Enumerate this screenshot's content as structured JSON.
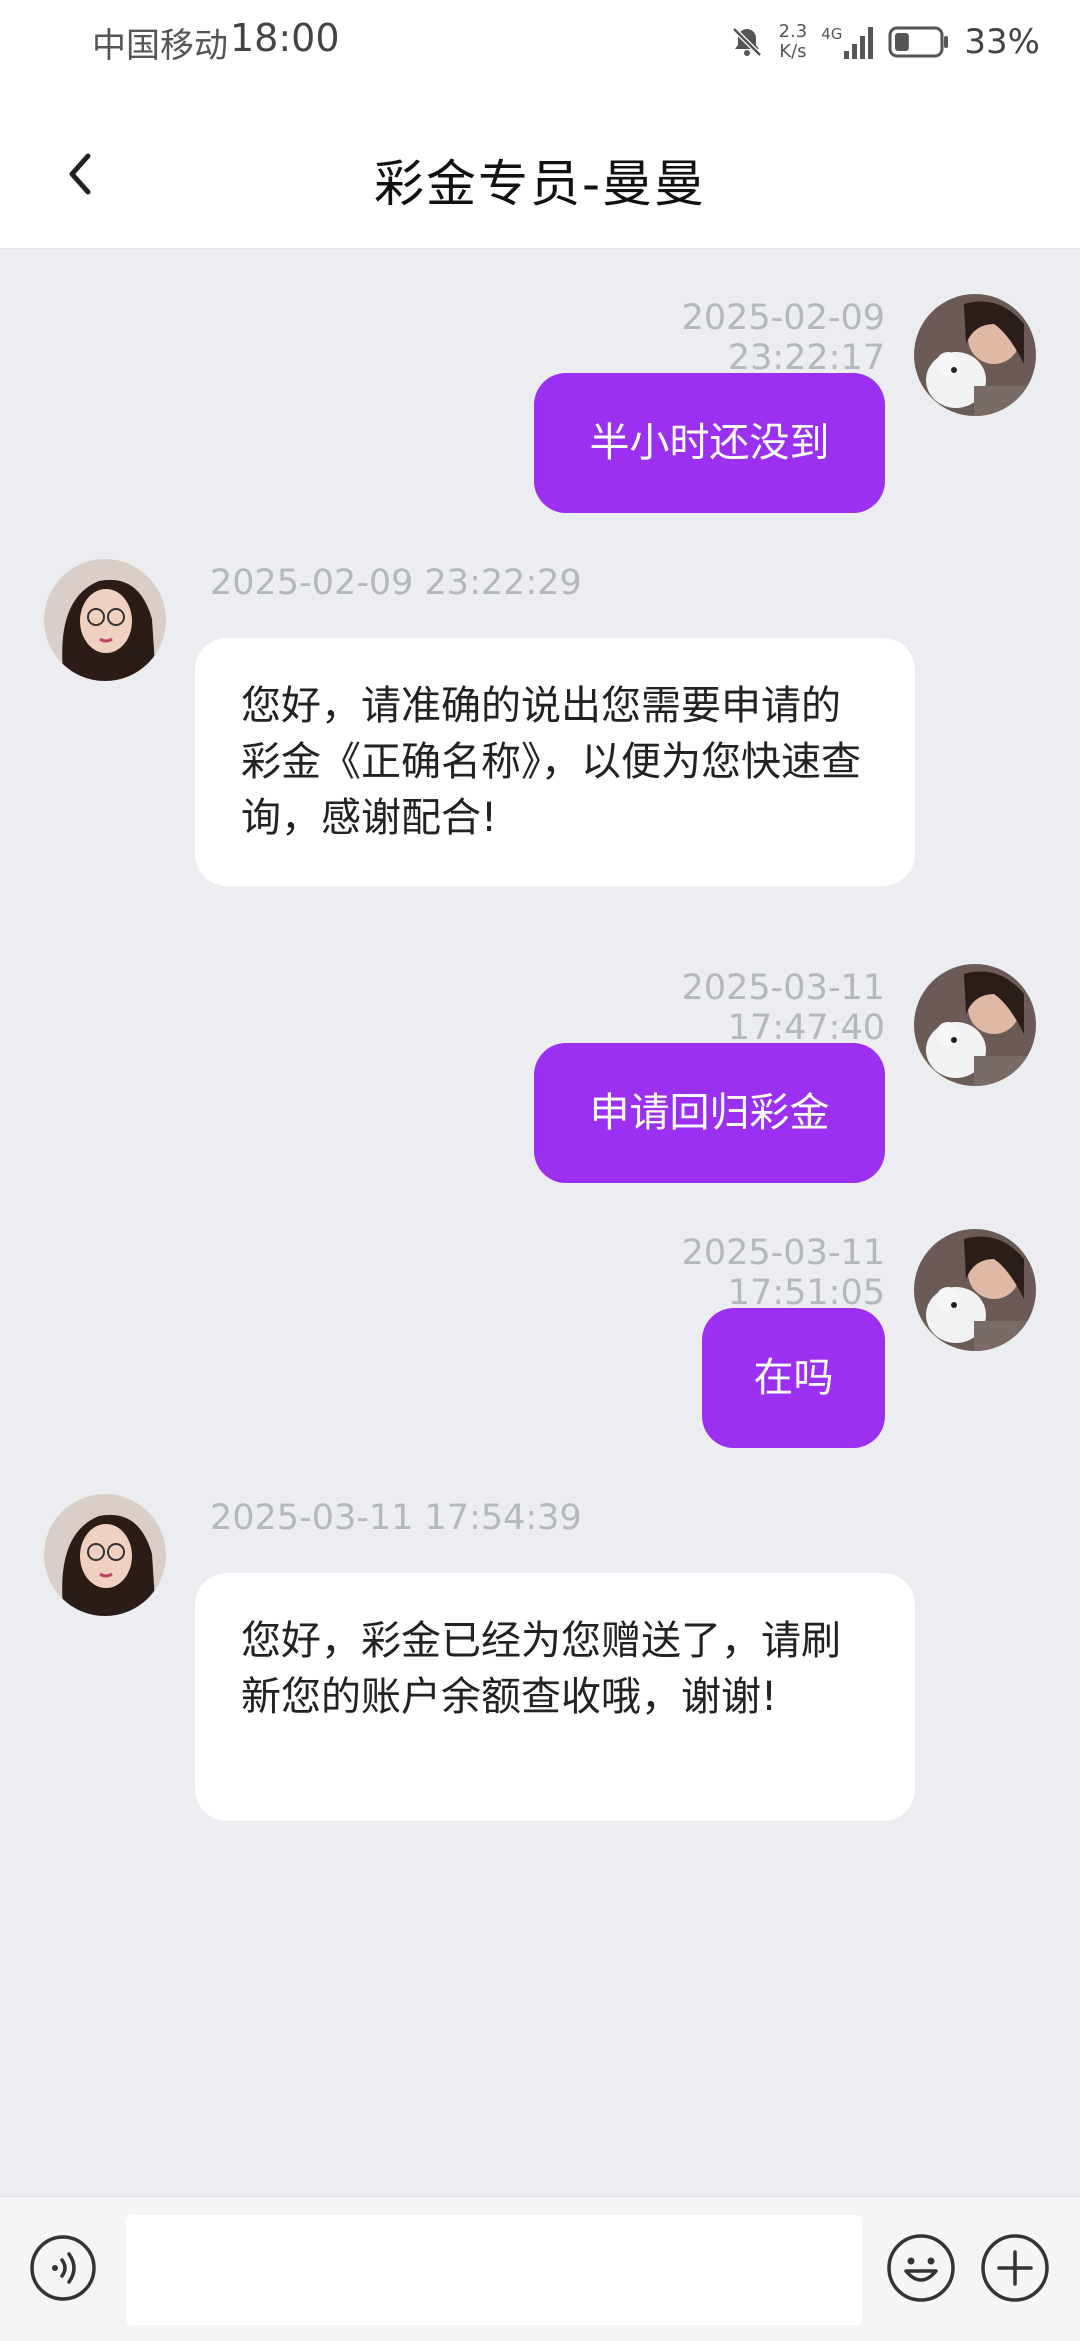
{
  "status_bar": {
    "carrier": "中国移动",
    "time": "18:00",
    "speed_value": "2.3",
    "speed_unit": "K/s",
    "network": "4G",
    "battery_percent": "33%",
    "battery_level": 0.33
  },
  "header": {
    "title": "彩金专员-曼曼"
  },
  "messages": [
    {
      "side": "me",
      "timestamp": "2025-02-09 23:22:17",
      "text": "半小时还没到"
    },
    {
      "side": "them",
      "timestamp": "2025-02-09 23:22:29",
      "text": "您好，请准确的说出您需要申请的彩金《正确名称》，以便为您快速查询，感谢配合!"
    },
    {
      "side": "me",
      "timestamp": "2025-03-11 17:47:40",
      "text": "申请回归彩金"
    },
    {
      "side": "me",
      "timestamp": "2025-03-11 17:51:05",
      "text": "在吗"
    },
    {
      "side": "them",
      "timestamp": "2025-03-11 17:54:39",
      "text": "您好，彩金已经为您赠送了，请刷新您的账户余额查收哦，谢谢!"
    }
  ],
  "input": {
    "value": "",
    "placeholder": ""
  },
  "colors": {
    "accent": "#9b30f0",
    "background": "#ecedf0",
    "timestamp": "#b5b7be"
  },
  "icons": [
    "back-icon",
    "voice-icon",
    "emoji-icon",
    "plus-icon",
    "mute-bell-icon",
    "signal-icon",
    "battery-icon"
  ]
}
